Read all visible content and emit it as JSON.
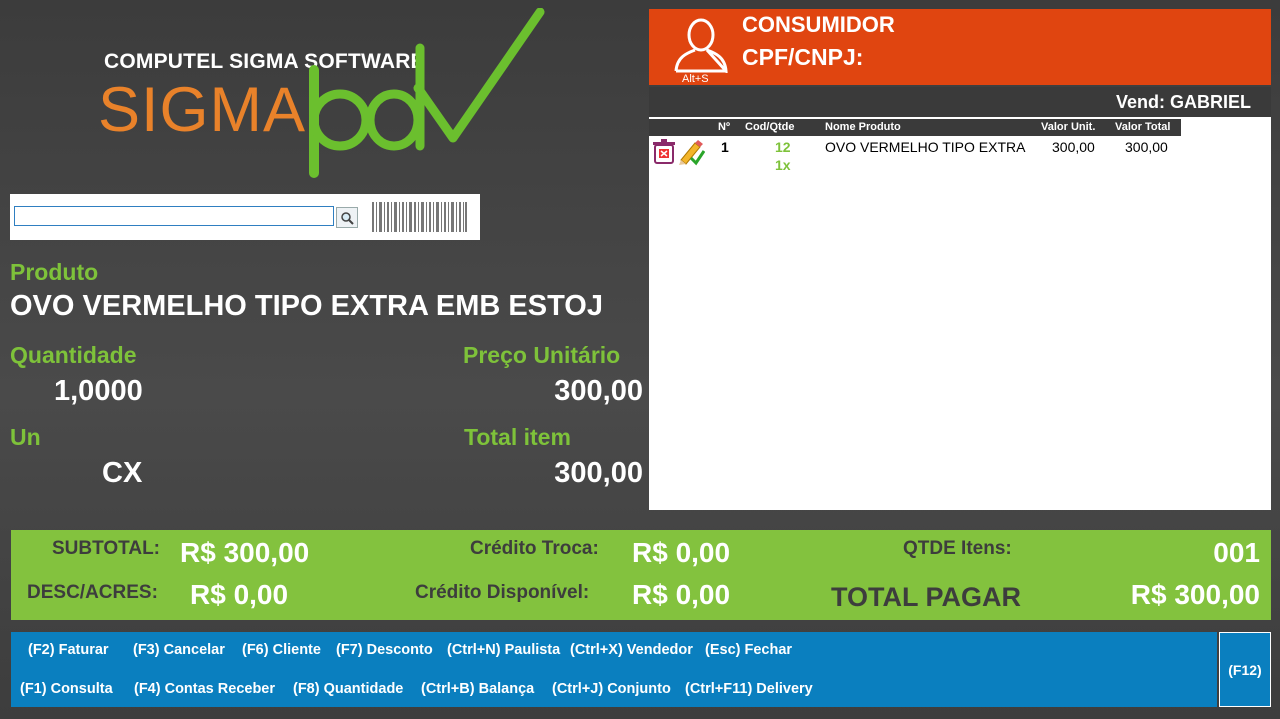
{
  "logo": {
    "top_text": "COMPUTEL SIGMA SOFTWARE",
    "brand_sigma": "SIGMA",
    "brand_pdv": "pdv",
    "brand_orange": "#e9822a",
    "brand_green": "#6bbf2e"
  },
  "search": {
    "value": "",
    "search_icon": "magnifier-icon",
    "barcode_icon": "barcode-icon"
  },
  "product": {
    "label": "Produto",
    "name": "OVO VERMELHO TIPO EXTRA EMB ESTOJ"
  },
  "quantity": {
    "label": "Quantidade",
    "value": "1,0000"
  },
  "unit_price": {
    "label": "Preço Unitário",
    "value": "300,00"
  },
  "unit": {
    "label": "Un",
    "value": "CX"
  },
  "total_item": {
    "label": "Total item",
    "value": "300,00"
  },
  "consumer": {
    "title": "CONSUMIDOR",
    "cpf_label": "CPF/CNPJ:",
    "shortcut": "Alt+S",
    "icon": "user-icon",
    "color": "#e04510"
  },
  "vendor": {
    "text": "Vend: GABRIEL"
  },
  "items_table": {
    "columns": [
      "Nº",
      "Cod/Qtde",
      "Nome Produto",
      "Valor Unit.",
      "Valor Total"
    ],
    "rows": [
      {
        "n": "1",
        "cod": "12",
        "qtde": "1x",
        "name": "OVO VERMELHO TIPO EXTRA",
        "unit": "300,00",
        "total": "300,00"
      }
    ]
  },
  "totals": {
    "subtotal_label": "SUBTOTAL:",
    "subtotal_value": "R$ 300,00",
    "desc_label": "DESC/ACRES:",
    "desc_value": "R$ 0,00",
    "credito_troca_label": "Crédito Troca:",
    "credito_troca_value": "R$ 0,00",
    "credito_disp_label": "Crédito Disponível:",
    "credito_disp_value": "R$ 0,00",
    "qtde_label": "QTDE Itens:",
    "qtde_value": "001",
    "total_label": "TOTAL PAGAR",
    "total_value": "R$ 300,00",
    "color": "#83c23e"
  },
  "shortcuts": {
    "row1": [
      "(F2) Faturar",
      "(F3) Cancelar",
      "(F6) Cliente",
      "(F7) Desconto",
      "(Ctrl+N) Paulista",
      "(Ctrl+X) Vendedor",
      "(Esc) Fechar"
    ],
    "row2": [
      "(F1) Consulta",
      "(F4) Contas Receber",
      "(F8) Quantidade",
      "(Ctrl+B) Balança",
      "(Ctrl+J) Conjunto",
      "(Ctrl+F11) Delivery"
    ],
    "f12": "(F12)",
    "color": "#0a7fbf"
  }
}
